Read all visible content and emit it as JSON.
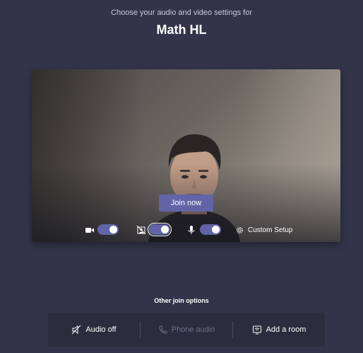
{
  "header": {
    "subtitle": "Choose your audio and video settings for",
    "meeting_title": "Math HL"
  },
  "preview": {
    "join_label": "Join now",
    "controls": {
      "camera": {
        "icon": "video-camera-icon",
        "on": true
      },
      "blur": {
        "icon": "background-blur-icon",
        "on": true
      },
      "microphone": {
        "icon": "microphone-icon",
        "on": true
      },
      "custom_setup_label": "Custom Setup",
      "custom_setup_icon": "gear-icon"
    }
  },
  "other_options": {
    "title": "Other join options",
    "items": [
      {
        "label": "Audio off",
        "icon": "speaker-off-icon",
        "enabled": true
      },
      {
        "label": "Phone audio",
        "icon": "phone-icon",
        "enabled": false
      },
      {
        "label": "Add a room",
        "icon": "room-cast-icon",
        "enabled": true
      }
    ]
  },
  "colors": {
    "background": "#33344a",
    "accent": "#6264a7",
    "options_bar": "#2d2c3e"
  }
}
